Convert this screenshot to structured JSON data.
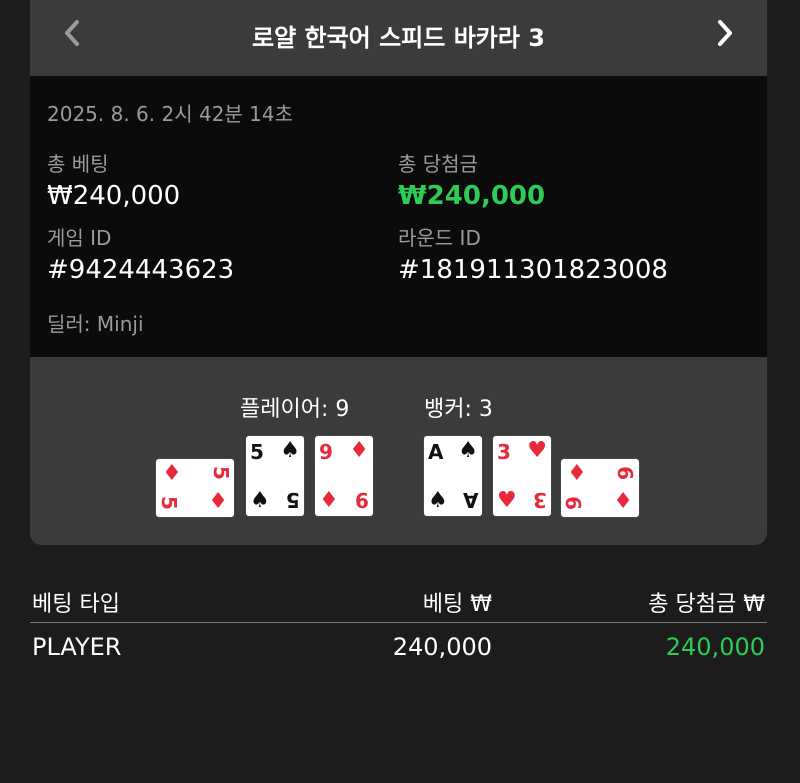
{
  "header": {
    "title": "로얄 한국어 스피드 바카라 3"
  },
  "details": {
    "date": "2025. 8. 6. 2시 42분 14초",
    "total_bet_label": "총 베팅",
    "total_bet_value": "₩240,000",
    "total_win_label": "총 당첨금",
    "total_win_value": "₩240,000",
    "game_id_label": "게임 ID",
    "game_id_value": "#9424443623",
    "round_id_label": "라운드 ID",
    "round_id_value": "#181911301823008",
    "dealer": "딜러: Minji"
  },
  "result": {
    "player_score": "플레이어: 9",
    "banker_score": "뱅커: 3",
    "player_cards": [
      {
        "rank": "5",
        "suit": "diamond"
      },
      {
        "rank": "5",
        "suit": "spade"
      },
      {
        "rank": "9",
        "suit": "diamond"
      }
    ],
    "banker_cards": [
      {
        "rank": "A",
        "suit": "spade"
      },
      {
        "rank": "3",
        "suit": "heart"
      },
      {
        "rank": "9",
        "suit": "diamond"
      }
    ]
  },
  "bets_table": {
    "col_type": "베팅 타입",
    "col_bet": "베팅 ₩",
    "col_win": "총 당첨금 ₩",
    "rows": [
      {
        "type": "PLAYER",
        "bet": "240,000",
        "win": "240,000"
      }
    ]
  },
  "colors": {
    "win_green": "#2ecc55",
    "card_red": "#e8293b",
    "panel_bg": "#3b3b3b",
    "info_bg": "#0b0b0b"
  }
}
